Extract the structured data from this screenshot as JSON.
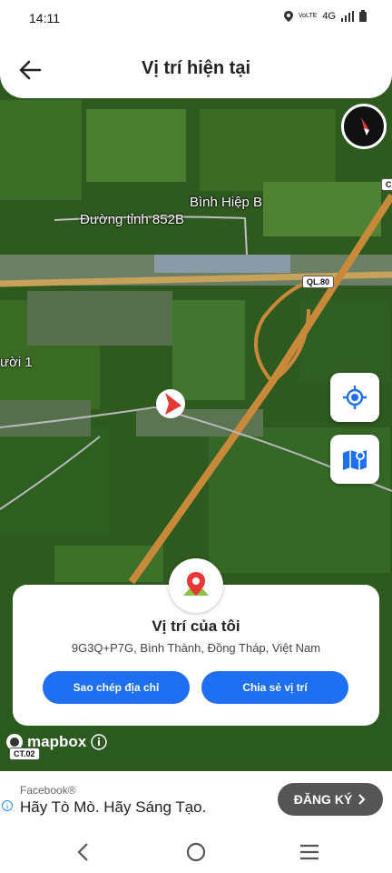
{
  "status_bar": {
    "time": "14:11",
    "network": "4G",
    "volte": "VoLTE"
  },
  "header": {
    "title": "Vị trí hiện tại"
  },
  "map": {
    "labels": {
      "village": "Bình Hiệp B",
      "road": "Đường tỉnh 852B",
      "partial_place": "ười 1"
    },
    "shields": {
      "highway": "QL.80",
      "corner": "CT.02",
      "edge": "C"
    },
    "attribution": "mapbox"
  },
  "card": {
    "title": "Vị trí của tôi",
    "address": "9G3Q+P7G, Bình Thành, Đồng Tháp, Việt Nam",
    "copy_button": "Sao chép địa chỉ",
    "share_button": "Chia sẻ vị trí"
  },
  "ad": {
    "advertiser": "Facebook®",
    "headline": "Hãy Tò Mò. Hãy Sáng Tạo.",
    "cta": "ĐĂNG KÝ"
  },
  "colors": {
    "primary": "#1f6ff2",
    "map_field": "#2e5a1f",
    "compass_red": "#e53935"
  },
  "icons": [
    "back-arrow-icon",
    "compass-icon",
    "my-location-icon",
    "map-layers-icon",
    "location-pin-icon",
    "info-icon",
    "chevron-right-icon",
    "nav-back-icon",
    "nav-home-icon",
    "nav-menu-icon"
  ]
}
